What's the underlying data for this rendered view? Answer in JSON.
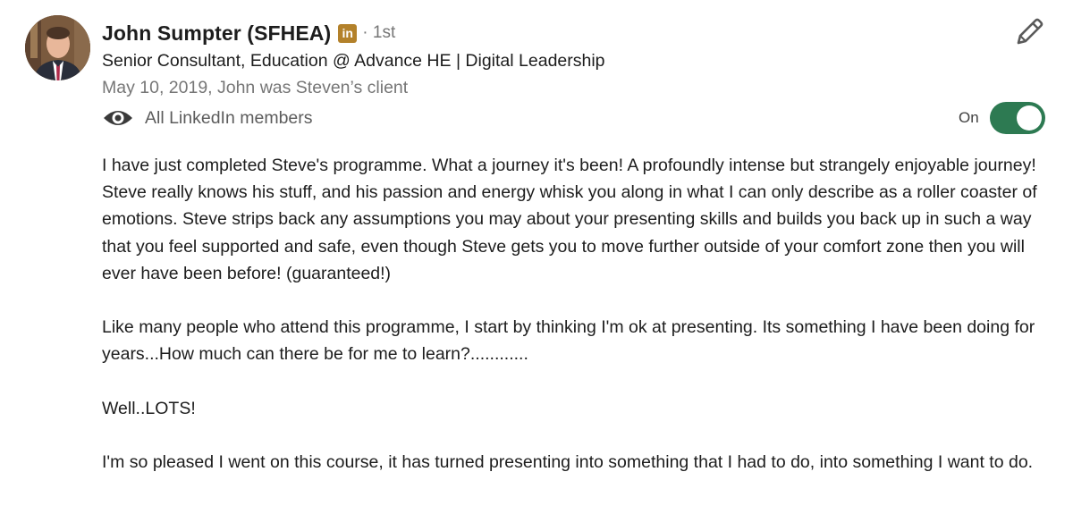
{
  "recommender": {
    "name": "John Sumpter (SFHEA)",
    "badge": "in",
    "degree": "· 1st",
    "headline": "Senior Consultant, Education @ Advance HE | Digital Leadership",
    "date_relationship": "May 10, 2019, John was Steven’s client"
  },
  "visibility": {
    "icon": "eye-icon",
    "label": "All LinkedIn members"
  },
  "toggle": {
    "label": "On",
    "state": "on",
    "color": "#2d7a52"
  },
  "edit": {
    "icon": "pencil-icon"
  },
  "recommendation": {
    "paragraphs": [
      "I have just completed Steve's programme. What a journey it's been! A profoundly intense but strangely enjoyable journey! Steve really knows his stuff, and his passion and energy whisk you along in what I can only describe as a roller coaster of emotions. Steve strips back any assumptions you may about your presenting skills and builds you back up in such a way that you feel supported and safe, even though Steve gets you to move further outside of your comfort zone then you will ever have been before! (guaranteed!)",
      "Like many people who attend this programme, I start by thinking I'm ok at presenting. Its something I have been doing for years...How much can there be for me to learn?............",
      "Well..LOTS!",
      "I'm so pleased I went on this course, it has turned presenting into something that I had to do, into something I want to do."
    ]
  },
  "colors": {
    "badge": "#b3812a",
    "muted_text": "#767676"
  }
}
